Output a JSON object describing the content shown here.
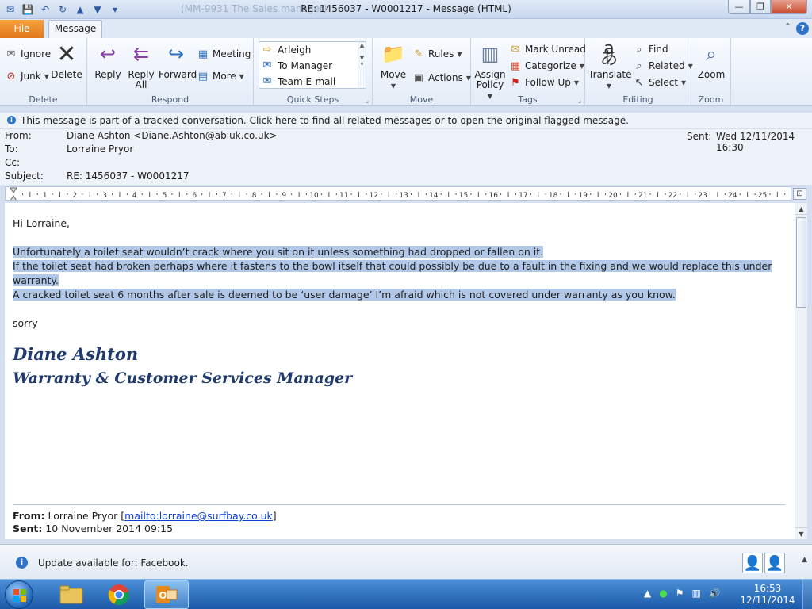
{
  "window": {
    "title": "RE: 1456037  - W0001217 - Message (HTML)",
    "faded_title": "(MM-9931 The Sales manager)",
    "controls": {
      "minimize": "—",
      "maximize": "❐",
      "close": "✕"
    }
  },
  "tabs": {
    "file": "File",
    "message": "Message"
  },
  "ribbon": {
    "delete_group": {
      "label": "Delete",
      "ignore": "Ignore",
      "junk": "Junk",
      "delete": "Delete"
    },
    "respond_group": {
      "label": "Respond",
      "reply": "Reply",
      "reply_all_1": "Reply",
      "reply_all_2": "All",
      "forward": "Forward",
      "meeting": "Meeting",
      "more": "More"
    },
    "quick_steps_group": {
      "label": "Quick Steps",
      "items": [
        "Arleigh",
        "To Manager",
        "Team E-mail"
      ]
    },
    "move_group": {
      "label": "Move",
      "move": "Move",
      "rules": "Rules",
      "actions": "Actions"
    },
    "tags_group": {
      "label": "Tags",
      "assign_policy_1": "Assign",
      "assign_policy_2": "Policy",
      "mark_unread": "Mark Unread",
      "categorize": "Categorize",
      "follow_up": "Follow Up"
    },
    "editing_group": {
      "label": "Editing",
      "translate": "Translate",
      "find": "Find",
      "related": "Related",
      "select": "Select"
    },
    "zoom_group": {
      "label": "Zoom",
      "zoom": "Zoom"
    }
  },
  "infobar": {
    "text": "This message is part of a tracked conversation. Click here to find all related messages or to open the original flagged message."
  },
  "header": {
    "from_label": "From:",
    "from_value": "Diane Ashton <Diane.Ashton@abiuk.co.uk>",
    "to_label": "To:",
    "to_value": "Lorraine Pryor",
    "cc_label": "Cc:",
    "cc_value": "",
    "subject_label": "Subject:",
    "subject_value": "RE: 1456037  - W0001217",
    "sent_label": "Sent:",
    "sent_value": "Wed 12/11/2014 16:30"
  },
  "ruler": {
    "numbers": [
      "1",
      "2",
      "3",
      "4",
      "5",
      "6",
      "7",
      "8",
      "9",
      "10",
      "11",
      "12",
      "13",
      "14",
      "15",
      "16",
      "17",
      "18",
      "19",
      "20",
      "21",
      "22",
      "23",
      "24",
      "25"
    ]
  },
  "body": {
    "greeting": "Hi Lorraine,",
    "line1": "Unfortunately a toilet seat wouldn’t crack where you sit on it unless something had dropped or fallen on it.",
    "line2": "If the toilet seat had broken perhaps where it fastens to the bowl itself that could possibly be due to a fault in the fixing and we would replace this under",
    "line3": "warranty.",
    "line4": "A cracked toilet seat 6 months after sale is deemed to be ‘user damage’  I’m afraid which is not covered under warranty as you know.",
    "closing": "sorry",
    "sig_name": "Diane Ashton",
    "sig_title": "Warranty & Customer Services Manager",
    "quoted_from_label": "From:",
    "quoted_from_value": "Lorraine Pryor [",
    "quoted_from_link": "mailto:lorraine@surfbay.co.uk",
    "quoted_from_end": "]",
    "quoted_sent_label": "Sent:",
    "quoted_sent_value": "10 November 2014 09:15"
  },
  "people_pane": {
    "text": "Update available for: Facebook."
  },
  "taskbar": {
    "time": "16:53",
    "date": "12/11/2014"
  },
  "colors": {
    "accent_orange": "#e2771a",
    "highlight": "#b1c8e8",
    "signature": "#1f3b6e",
    "link": "#0b3fd6",
    "taskbar": "#1b5aa8"
  }
}
